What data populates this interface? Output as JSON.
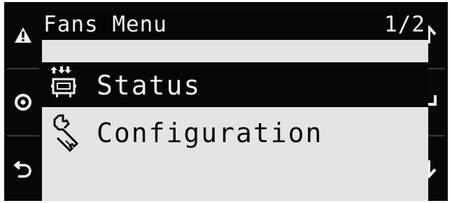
{
  "title_bar": {
    "title": "Fans Menu",
    "page_indicator": "1/2"
  },
  "menu": {
    "items": [
      {
        "label": "Status",
        "icon": "fan-status-icon",
        "selected": true
      },
      {
        "label": "Configuration",
        "icon": "wrench-icon",
        "selected": false
      }
    ]
  },
  "side_buttons": {
    "left": [
      "alarm-icon",
      "program-icon",
      "escape-icon"
    ],
    "right": [
      "up-arrow-icon",
      "enter-icon",
      "down-arrow-icon"
    ]
  },
  "colors": {
    "frame": "#070707",
    "screen_background": "#e4e4e4",
    "selected_background": "#060606",
    "selected_text": "#f0f0f0",
    "text": "#0b0b0b"
  }
}
